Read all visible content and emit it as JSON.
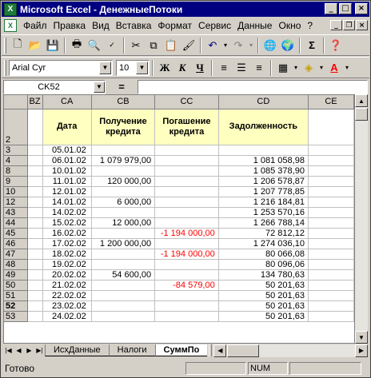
{
  "window": {
    "title": "Microsoft Excel - ДенежныеПотоки"
  },
  "menu": {
    "items": [
      "Файл",
      "Правка",
      "Вид",
      "Вставка",
      "Формат",
      "Сервис",
      "Данные",
      "Окно",
      "?"
    ]
  },
  "format_toolbar": {
    "font_name": "Arial Cyr",
    "font_size": "10",
    "bold": "Ж",
    "italic": "К",
    "underline": "Ч"
  },
  "formula_bar": {
    "name_box": "CK52",
    "equals": "="
  },
  "grid": {
    "columns": [
      "BZ",
      "CA",
      "CB",
      "CC",
      "CD",
      "CE"
    ],
    "header_row": {
      "row": "2",
      "CA": "Дата",
      "CB": "Получение кредита",
      "CC": "Погашение кредита",
      "CD": "Задолженность"
    },
    "rows": [
      {
        "row": "3",
        "CA": "05.01.02",
        "CB": "",
        "CC": "",
        "CD": ""
      },
      {
        "row": "4",
        "CA": "06.01.02",
        "CB": "1 079 979,00",
        "CC": "",
        "CD": "1 081 058,98"
      },
      {
        "row": "8",
        "CA": "10.01.02",
        "CB": "",
        "CC": "",
        "CD": "1 085 378,90"
      },
      {
        "row": "9",
        "CA": "11.01.02",
        "CB": "120 000,00",
        "CC": "",
        "CD": "1 206 578,87"
      },
      {
        "row": "10",
        "CA": "12.01.02",
        "CB": "",
        "CC": "",
        "CD": "1 207 778,85"
      },
      {
        "row": "12",
        "CA": "14.01.02",
        "CB": "6 000,00",
        "CC": "",
        "CD": "1 216 184,81"
      },
      {
        "row": "43",
        "CA": "14.02.02",
        "CB": "",
        "CC": "",
        "CD": "1 253 570,16"
      },
      {
        "row": "44",
        "CA": "15.02.02",
        "CB": "12 000,00",
        "CC": "",
        "CD": "1 266 788,14"
      },
      {
        "row": "45",
        "CA": "16.02.02",
        "CB": "",
        "CC": "-1 194 000,00",
        "CD": "72 812,12"
      },
      {
        "row": "46",
        "CA": "17.02.02",
        "CB": "1 200 000,00",
        "CC": "",
        "CD": "1 274 036,10"
      },
      {
        "row": "47",
        "CA": "18.02.02",
        "CB": "",
        "CC": "-1 194 000,00",
        "CD": "80 066,08"
      },
      {
        "row": "48",
        "CA": "19.02.02",
        "CB": "",
        "CC": "",
        "CD": "80 096,06"
      },
      {
        "row": "49",
        "CA": "20.02.02",
        "CB": "54 600,00",
        "CC": "",
        "CD": "134 780,63"
      },
      {
        "row": "50",
        "CA": "21.02.02",
        "CB": "",
        "CC": "-84 579,00",
        "CD": "50 201,63"
      },
      {
        "row": "51",
        "CA": "22.02.02",
        "CB": "",
        "CC": "",
        "CD": "50 201,63"
      },
      {
        "row": "52",
        "CA": "23.02.02",
        "CB": "",
        "CC": "",
        "CD": "50 201,63"
      },
      {
        "row": "53",
        "CA": "24.02.02",
        "CB": "",
        "CC": "",
        "CD": "50 201,63"
      }
    ],
    "active_row": "52",
    "negative_color": "#ff0000",
    "header_fill": "#ffffc0"
  },
  "sheet_tabs": {
    "items": [
      "ИсхДанные",
      "Налоги",
      "СуммПо"
    ],
    "active": "СуммПо"
  },
  "status": {
    "text": "Готово",
    "num": "NUM"
  },
  "colors": {
    "titlebar": "#000080",
    "chrome": "#d4d0c8"
  }
}
